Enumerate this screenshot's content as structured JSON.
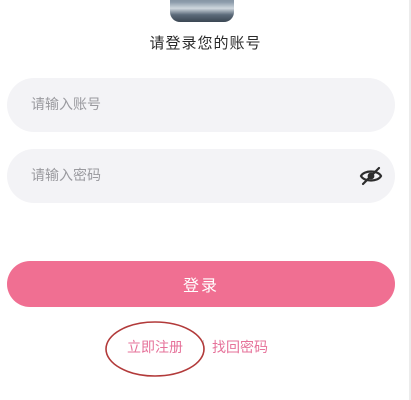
{
  "header": {
    "subtitle": "请登录您的账号"
  },
  "form": {
    "account_placeholder": "请输入账号",
    "account_value": "",
    "password_placeholder": "请输入密码",
    "password_value": "",
    "password_toggle_icon": "eye-icon"
  },
  "actions": {
    "login_label": "登录",
    "register_label": "立即注册",
    "forgot_label": "找回密码"
  },
  "colors": {
    "accent": "#f06f92",
    "link": "#e6729a",
    "field_bg": "#f3f3f6",
    "annotation": "#b23a3a"
  }
}
